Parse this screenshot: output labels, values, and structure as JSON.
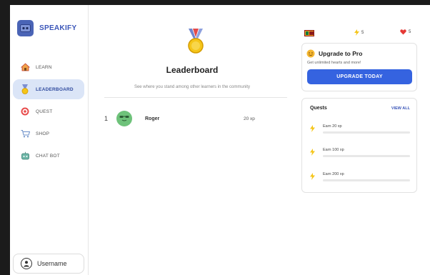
{
  "brand": {
    "name": "SPEAKIFY"
  },
  "nav": [
    {
      "label": "LEARN",
      "icon": "home-icon",
      "active": false
    },
    {
      "label": "LEADERBOARD",
      "icon": "medal-icon",
      "active": true
    },
    {
      "label": "QUEST",
      "icon": "target-icon",
      "active": false
    },
    {
      "label": "SHOP",
      "icon": "cart-icon",
      "active": false
    },
    {
      "label": "CHAT BOT",
      "icon": "robot-icon",
      "active": false
    }
  ],
  "user": {
    "name": "Username"
  },
  "leaderboard": {
    "title": "Leaderboard",
    "subtitle": "See where you stand among other learners in the community",
    "rows": [
      {
        "rank": "1",
        "name": "Roger",
        "xp": "20 xp"
      }
    ]
  },
  "stats": {
    "streak": "5",
    "hearts": "5"
  },
  "pro": {
    "title": "Upgrade to Pro",
    "subtitle": "Get unlimited hearts and more!",
    "button": "UPGRADE TODAY"
  },
  "quests": {
    "title": "Quests",
    "view_all": "VIEW ALL",
    "items": [
      {
        "label": "Earn 20 xp",
        "progress": 0
      },
      {
        "label": "Earn 100 xp",
        "progress": 0
      },
      {
        "label": "Earn 200 xp",
        "progress": 0
      }
    ]
  },
  "colors": {
    "accent": "#3563e0",
    "brand": "#3a55b8",
    "active_nav": "#dbe5f7",
    "xp_yellow": "#f5c518",
    "heart": "#e53935"
  }
}
